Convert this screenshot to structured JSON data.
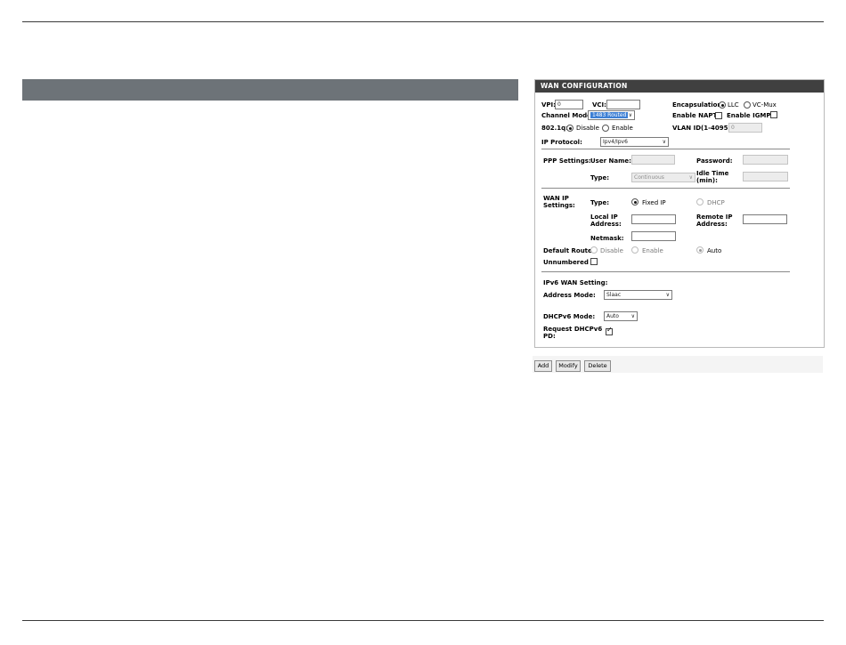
{
  "panel": {
    "title": "WAN CONFIGURATION",
    "vpi_label": "VPI:",
    "vpi_value": "0",
    "vci_label": "VCI:",
    "vci_value": "",
    "encapsulation_label": "Encapsulation:",
    "encap_llc": "LLC",
    "encap_vcmux": "VC-Mux",
    "encapsulation_selected": "LLC",
    "channel_mode_label": "Channel Mode:",
    "channel_mode_value": "1483 Routed",
    "enable_napt_label": "Enable NAPT:",
    "enable_igmp_label": "Enable IGMP:",
    "dot1q_label": "802.1q:",
    "dot1q_disable": "Disable",
    "dot1q_enable": "Enable",
    "vlan_id_label": "VLAN ID(1-4095):",
    "vlan_id_value": "0",
    "ip_protocol_label": "IP Protocol:",
    "ip_protocol_value": "Ipv4/Ipv6"
  },
  "ppp": {
    "settings_label": "PPP Settings:",
    "user_name_label": "User Name:",
    "password_label": "Password:",
    "type_label": "Type:",
    "type_value": "Continuous",
    "idle_time_label_line1": "Idle Time",
    "idle_time_label_line2": "(min):"
  },
  "wan_ip": {
    "settings_label_line1": "WAN IP",
    "settings_label_line2": "Settings:",
    "type_label": "Type:",
    "fixed_ip": "Fixed IP",
    "dhcp": "DHCP",
    "local_ip_line1": "Local IP",
    "local_ip_line2": "Address:",
    "remote_ip_line1": "Remote IP",
    "remote_ip_line2": "Address:",
    "netmask_label": "Netmask:",
    "default_route_label": "Default Route:",
    "route_disable": "Disable",
    "route_enable": "Enable",
    "route_auto": "Auto",
    "unnumbered_label": "Unnumbered"
  },
  "ipv6": {
    "section_label": "IPv6 WAN Setting:",
    "address_mode_label": "Address Mode:",
    "address_mode_value": "Slaac",
    "dhcpv6_mode_label": "DHCPv6 Mode:",
    "dhcpv6_mode_value": "Auto",
    "request_pd_line1": "Request DHCPv6",
    "request_pd_line2": "PD:",
    "request_pd_checked": true
  },
  "buttons": {
    "add": "Add",
    "modify": "Modify",
    "delete": "Delete"
  }
}
